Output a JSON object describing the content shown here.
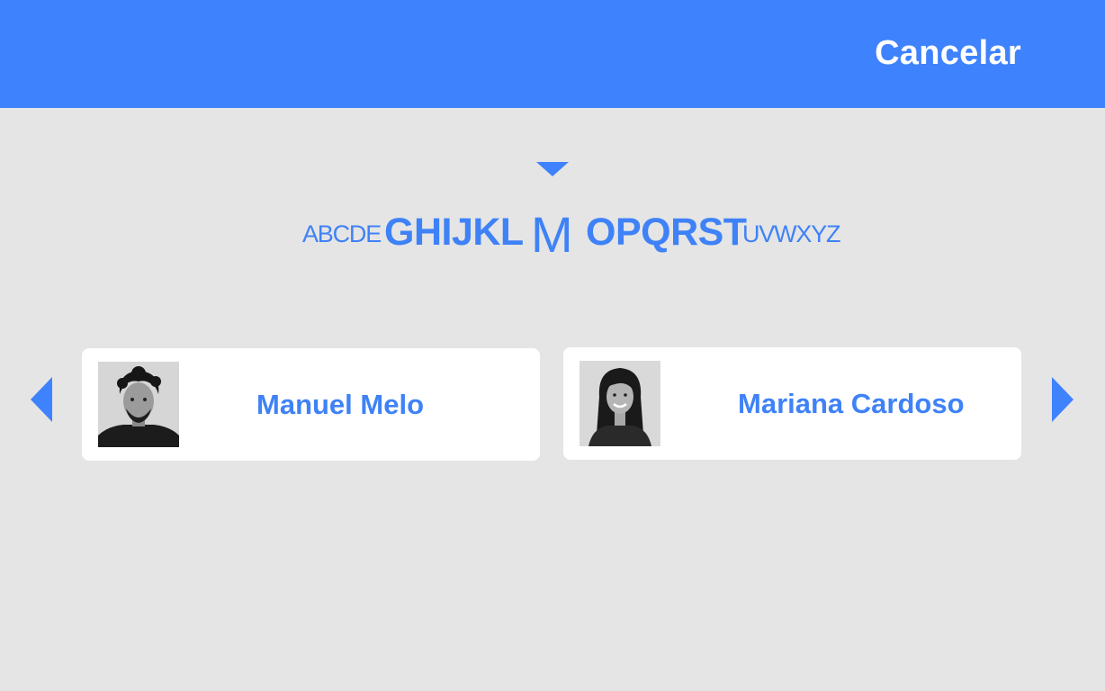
{
  "header": {
    "cancel_label": "Cancelar"
  },
  "alphabet": {
    "groups": [
      {
        "label": "ABCDE",
        "state": "far"
      },
      {
        "label": "GHIJKL",
        "state": "near"
      },
      {
        "label": "M",
        "state": "selected"
      },
      {
        "label": "OPQRST",
        "state": "near"
      },
      {
        "label": "UVWXYZ",
        "state": "far"
      }
    ],
    "selected_letter": "M"
  },
  "people": [
    {
      "name": "Manuel Melo",
      "photo_icon": "person-photo-male"
    },
    {
      "name": "Mariana Cardoso",
      "photo_icon": "person-photo-female"
    }
  ],
  "navigation": {
    "prev_icon": "triangle-left-icon",
    "next_icon": "triangle-right-icon"
  },
  "colors": {
    "accent": "#3f82fd",
    "background": "#e5e5e5",
    "card": "#ffffff"
  }
}
